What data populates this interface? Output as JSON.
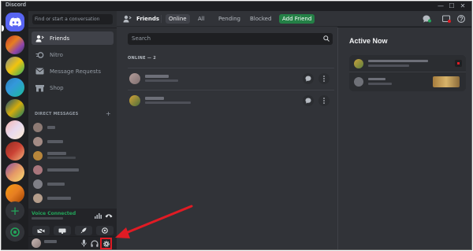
{
  "app": {
    "title": "Discord"
  },
  "window_controls": {
    "minimize": "—",
    "maximize": "☐",
    "close": "✕"
  },
  "sidebar": {
    "search_placeholder": "Find or start a conversation",
    "nav": [
      {
        "label": "Friends",
        "icon": "friends-wave-icon",
        "active": true
      },
      {
        "label": "Nitro",
        "icon": "nitro-icon",
        "active": false
      },
      {
        "label": "Message Requests",
        "icon": "envelope-icon",
        "active": false
      },
      {
        "label": "Shop",
        "icon": "shop-icon",
        "active": false
      }
    ],
    "dm_header": "DIRECT MESSAGES",
    "dm_add": "+"
  },
  "voice": {
    "status": "Voice Connected"
  },
  "topbar": {
    "title": "Friends",
    "tabs": [
      {
        "label": "Online",
        "selected": true
      },
      {
        "label": "All",
        "selected": false
      },
      {
        "label": "Pending",
        "selected": false
      },
      {
        "label": "Blocked",
        "selected": false
      }
    ],
    "add_friend": "Add Friend"
  },
  "main": {
    "search_placeholder": "Search",
    "online_header": "ONLINE — 2"
  },
  "active_now": {
    "title": "Active Now"
  },
  "colors": {
    "blurple": "#5865f2",
    "green": "#23a55a",
    "add_friend_green": "#248046",
    "highlight_red": "#e01b24"
  }
}
